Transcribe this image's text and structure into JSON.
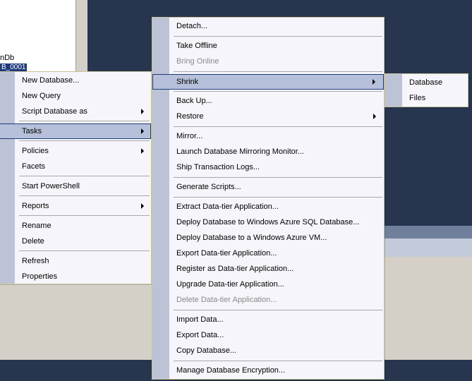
{
  "tree": {
    "db_fragment": "nDb",
    "selected_fragment": "B_0001"
  },
  "context_menu": {
    "items": [
      {
        "label": "New Database..."
      },
      {
        "label": "New Query"
      },
      {
        "label": "Script Database as"
      },
      {
        "label": "Tasks"
      },
      {
        "label": "Policies"
      },
      {
        "label": "Facets"
      },
      {
        "label": "Start PowerShell"
      },
      {
        "label": "Reports"
      },
      {
        "label": "Rename"
      },
      {
        "label": "Delete"
      },
      {
        "label": "Refresh"
      },
      {
        "label": "Properties"
      }
    ]
  },
  "tasks_menu": {
    "items": [
      {
        "label": "Detach..."
      },
      {
        "label": "Take Offline"
      },
      {
        "label": "Bring Online"
      },
      {
        "label": "Shrink"
      },
      {
        "label": "Back Up..."
      },
      {
        "label": "Restore"
      },
      {
        "label": "Mirror..."
      },
      {
        "label": "Launch Database Mirroring Monitor..."
      },
      {
        "label": "Ship Transaction Logs..."
      },
      {
        "label": "Generate Scripts..."
      },
      {
        "label": "Extract Data-tier Application..."
      },
      {
        "label": "Deploy Database to Windows Azure SQL Database..."
      },
      {
        "label": "Deploy Database to a Windows Azure VM..."
      },
      {
        "label": "Export Data-tier Application..."
      },
      {
        "label": "Register as Data-tier Application..."
      },
      {
        "label": "Upgrade Data-tier Application..."
      },
      {
        "label": "Delete Data-tier Application..."
      },
      {
        "label": "Import Data..."
      },
      {
        "label": "Export Data..."
      },
      {
        "label": "Copy Database..."
      },
      {
        "label": "Manage Database Encryption..."
      }
    ]
  },
  "shrink_menu": {
    "items": [
      {
        "label": "Database"
      },
      {
        "label": "Files"
      }
    ]
  },
  "colors": {
    "desktop_navy": "#27354f",
    "menu_background": "#f6f5fb",
    "menu_gutter": "#bcc3d6",
    "highlight_fill": "#b6c0da",
    "highlight_border": "#1f3a7a",
    "disabled_text": "#8a8a8a"
  }
}
